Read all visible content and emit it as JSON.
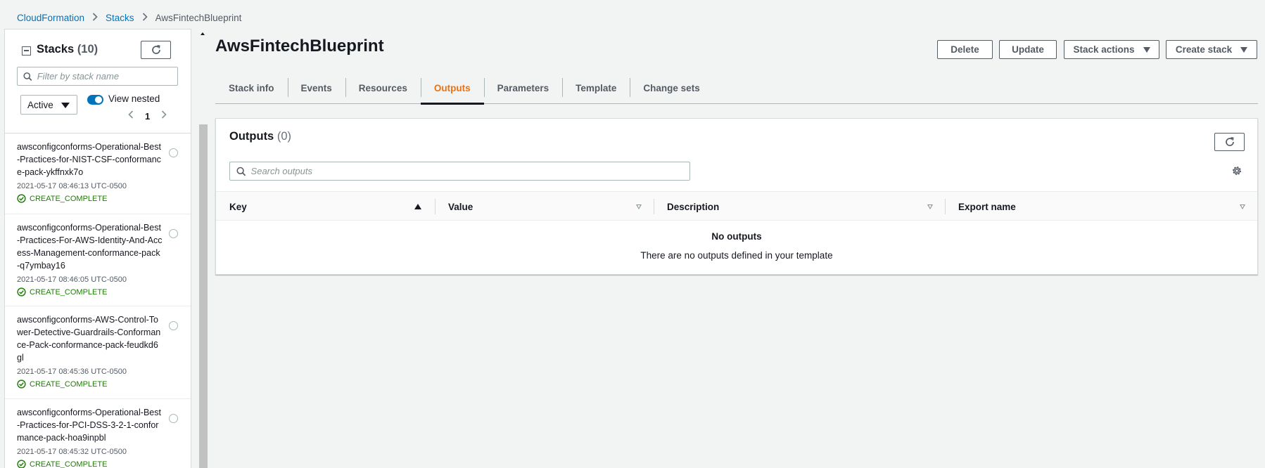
{
  "breadcrumb": {
    "items": [
      "CloudFormation",
      "Stacks"
    ],
    "current": "AwsFintechBlueprint"
  },
  "sidebar": {
    "title": "Stacks",
    "count": "(10)",
    "filter_placeholder": "Filter by stack name",
    "status_filter": "Active",
    "view_nested_label": "View nested",
    "view_nested_on": true,
    "page": "1",
    "stacks": [
      {
        "name": "awsconfigconforms-Operational-Best-Practices-for-NIST-CSF-conformance-pack-ykffnxk7o",
        "date": "2021-05-17 08:46:13 UTC-0500",
        "status": "CREATE_COMPLETE"
      },
      {
        "name": "awsconfigconforms-Operational-Best-Practices-For-AWS-Identity-And-Access-Management-conformance-pack-q7ymbay16",
        "date": "2021-05-17 08:46:05 UTC-0500",
        "status": "CREATE_COMPLETE"
      },
      {
        "name": "awsconfigconforms-AWS-Control-Tower-Detective-Guardrails-Conformance-Pack-conformance-pack-feudkd6gl",
        "date": "2021-05-17 08:45:36 UTC-0500",
        "status": "CREATE_COMPLETE"
      },
      {
        "name": "awsconfigconforms-Operational-Best-Practices-for-PCI-DSS-3-2-1-conformance-pack-hoa9inpbl",
        "date": "2021-05-17 08:45:32 UTC-0500",
        "status": "CREATE_COMPLETE"
      }
    ]
  },
  "main": {
    "title": "AwsFintechBlueprint",
    "buttons": {
      "delete": "Delete",
      "update": "Update",
      "stack_actions": "Stack actions",
      "create_stack": "Create stack"
    },
    "tabs": [
      "Stack info",
      "Events",
      "Resources",
      "Outputs",
      "Parameters",
      "Template",
      "Change sets"
    ],
    "active_tab": "Outputs"
  },
  "outputs": {
    "title": "Outputs",
    "count": "(0)",
    "search_placeholder": "Search outputs",
    "columns": [
      "Key",
      "Value",
      "Description",
      "Export name"
    ],
    "empty_title": "No outputs",
    "empty_desc": "There are no outputs defined in your template"
  },
  "colors": {
    "link": "#0073bb",
    "active_tab": "#ec7211",
    "success": "#1d8102",
    "toggle": "#0073bb"
  }
}
